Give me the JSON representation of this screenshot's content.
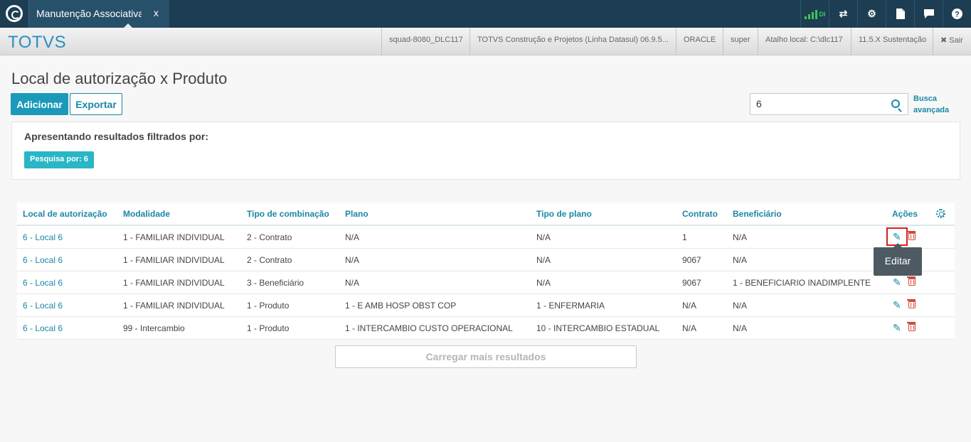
{
  "topbar": {
    "tab_label": "Manutenção Associativa",
    "tab_close": "x",
    "signal_text": "DI",
    "icons": [
      "network-signal-icon",
      "shuffle-icon",
      "settings-icon",
      "document-icon",
      "chat-icon",
      "help-icon"
    ]
  },
  "subbar": {
    "brand": "TOTVS",
    "items": [
      "squad-8080_DLC117",
      "TOTVS Construção e Projetos (Linha Datasul) 06.9.5...",
      "ORACLE",
      "super",
      "Atalho local: C:\\dlc117",
      "11.5.X Sustentação"
    ],
    "logout": "✖ Sair"
  },
  "page": {
    "title": "Local de autorização x Produto",
    "add_label": "Adicionar",
    "export_label": "Exportar",
    "search_value": "6",
    "advanced_line1": "Busca",
    "advanced_line2": "avançada"
  },
  "filter": {
    "title": "Apresentando resultados filtrados por:",
    "chip": "Pesquisa por: 6"
  },
  "table": {
    "headers": [
      "Local de autorização",
      "Modalidade",
      "Tipo de combinação",
      "Plano",
      "Tipo de plano",
      "Contrato",
      "Beneficiário",
      "Ações"
    ],
    "rows": [
      [
        "6 - Local 6",
        "1 - FAMILIAR INDIVIDUAL",
        "2 - Contrato",
        "N/A",
        "N/A",
        "1",
        "N/A"
      ],
      [
        "6 - Local 6",
        "1 - FAMILIAR INDIVIDUAL",
        "2 - Contrato",
        "N/A",
        "N/A",
        "9067",
        "N/A"
      ],
      [
        "6 - Local 6",
        "1 - FAMILIAR INDIVIDUAL",
        "3 - Beneficiário",
        "N/A",
        "N/A",
        "9067",
        "1 - BENEFICIARIO INADIMPLENTE"
      ],
      [
        "6 - Local 6",
        "1 - FAMILIAR INDIVIDUAL",
        "1 - Produto",
        "1 - E AMB HOSP OBST COP",
        "1 - ENFERMARIA",
        "N/A",
        "N/A"
      ],
      [
        "6 - Local 6",
        "99 - Intercambio",
        "1 - Produto",
        "1 - INTERCAMBIO CUSTO OPERACIONAL",
        "10 - INTERCAMBIO ESTADUAL",
        "N/A",
        "N/A"
      ]
    ],
    "tooltip": "Editar",
    "load_more": "Carregar mais resultados"
  }
}
